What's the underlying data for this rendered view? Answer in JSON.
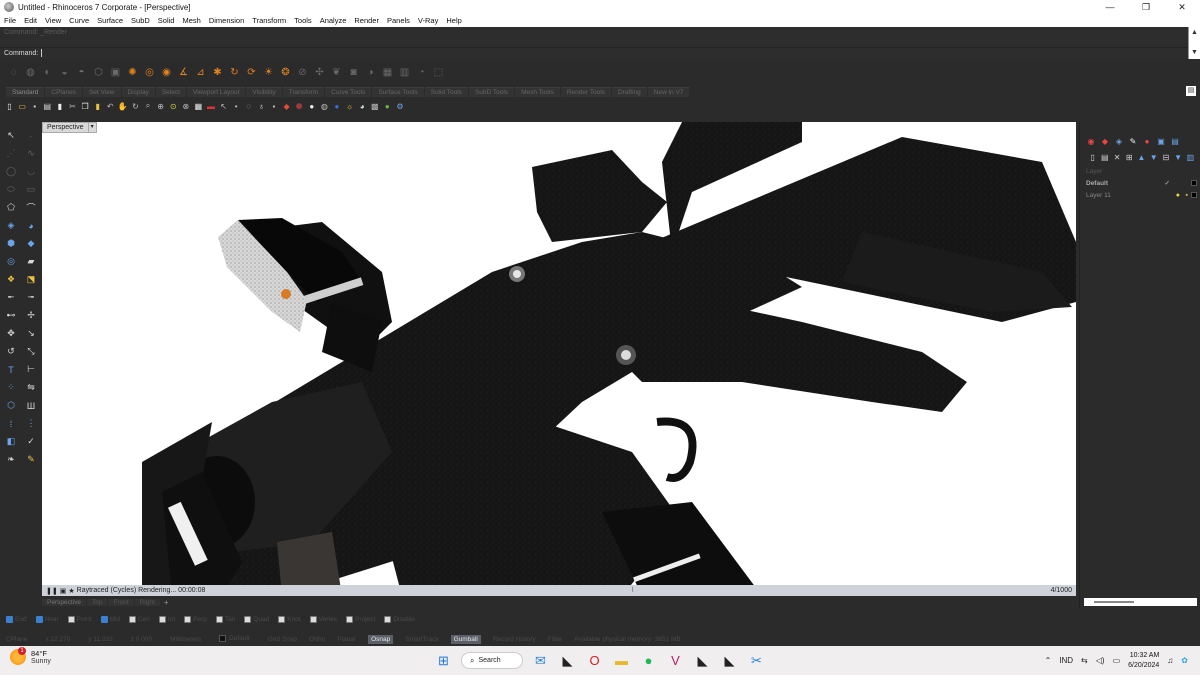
{
  "window": {
    "title": "Untitled - Rhinoceros 7 Corporate - [Perspective]",
    "minimize": "—",
    "restore": "❐",
    "close": "✕"
  },
  "menu": [
    "File",
    "Edit",
    "View",
    "Curve",
    "Surface",
    "SubD",
    "Solid",
    "Mesh",
    "Dimension",
    "Transform",
    "Tools",
    "Analyze",
    "Render",
    "Panels",
    "V-Ray",
    "Help"
  ],
  "command": {
    "history": "Command: _Render",
    "prompt": "Command:"
  },
  "toolbar_tabs": [
    "Standard",
    "CPlanes",
    "Set View",
    "Display",
    "Select",
    "Viewport Layout",
    "Visibility",
    "Transform",
    "Curve Tools",
    "Surface Tools",
    "Solid Tools",
    "SubD Tools",
    "Mesh Tools",
    "Render Tools",
    "Drafting",
    "New in V7"
  ],
  "viewport": {
    "name": "Perspective",
    "dropdown": "▾"
  },
  "render_status": {
    "text": "Raytraced (Cycles)   Rendering...  00:00:08",
    "samples": "4/1000"
  },
  "viewport_tabs": [
    "Perspective",
    "Top",
    "Front",
    "Right"
  ],
  "viewport_tab_add": "+",
  "osnaps": [
    {
      "label": "End",
      "checked": true
    },
    {
      "label": "Near",
      "checked": true
    },
    {
      "label": "Point",
      "checked": false
    },
    {
      "label": "Mid",
      "checked": true
    },
    {
      "label": "Cen",
      "checked": false
    },
    {
      "label": "Int",
      "checked": false
    },
    {
      "label": "Perp",
      "checked": false
    },
    {
      "label": "Tan",
      "checked": false
    },
    {
      "label": "Quad",
      "checked": false
    },
    {
      "label": "Knot",
      "checked": false
    },
    {
      "label": "Vertex",
      "checked": false
    },
    {
      "label": "Project",
      "checked": false
    },
    {
      "label": "Disable",
      "checked": false
    }
  ],
  "status_bar": {
    "cplane": "CPlane",
    "x": "x 22.270",
    "y": "y 11.033",
    "z": "z 0.000",
    "units": "Millimeters",
    "layer": "Default",
    "panes": [
      {
        "label": "Grid Snap",
        "active": false
      },
      {
        "label": "Ortho",
        "active": false
      },
      {
        "label": "Planar",
        "active": false
      },
      {
        "label": "Osnap",
        "active": true
      },
      {
        "label": "SmartTrack",
        "active": false
      },
      {
        "label": "Gumball",
        "active": true
      },
      {
        "label": "Record History",
        "active": false
      },
      {
        "label": "Filter",
        "active": false
      }
    ],
    "memory": "Available physical memory: 3851 MB"
  },
  "layers_panel": {
    "header": "Layer",
    "layers": [
      {
        "name": "Default",
        "current": true
      },
      {
        "name": "Layer 11",
        "current": false
      }
    ]
  },
  "taskbar": {
    "temp": "84°F",
    "condition": "Sunny",
    "alert": "1",
    "search": "Search",
    "lang": "IND",
    "time": "10:32 AM",
    "date": "6/20/2024"
  }
}
